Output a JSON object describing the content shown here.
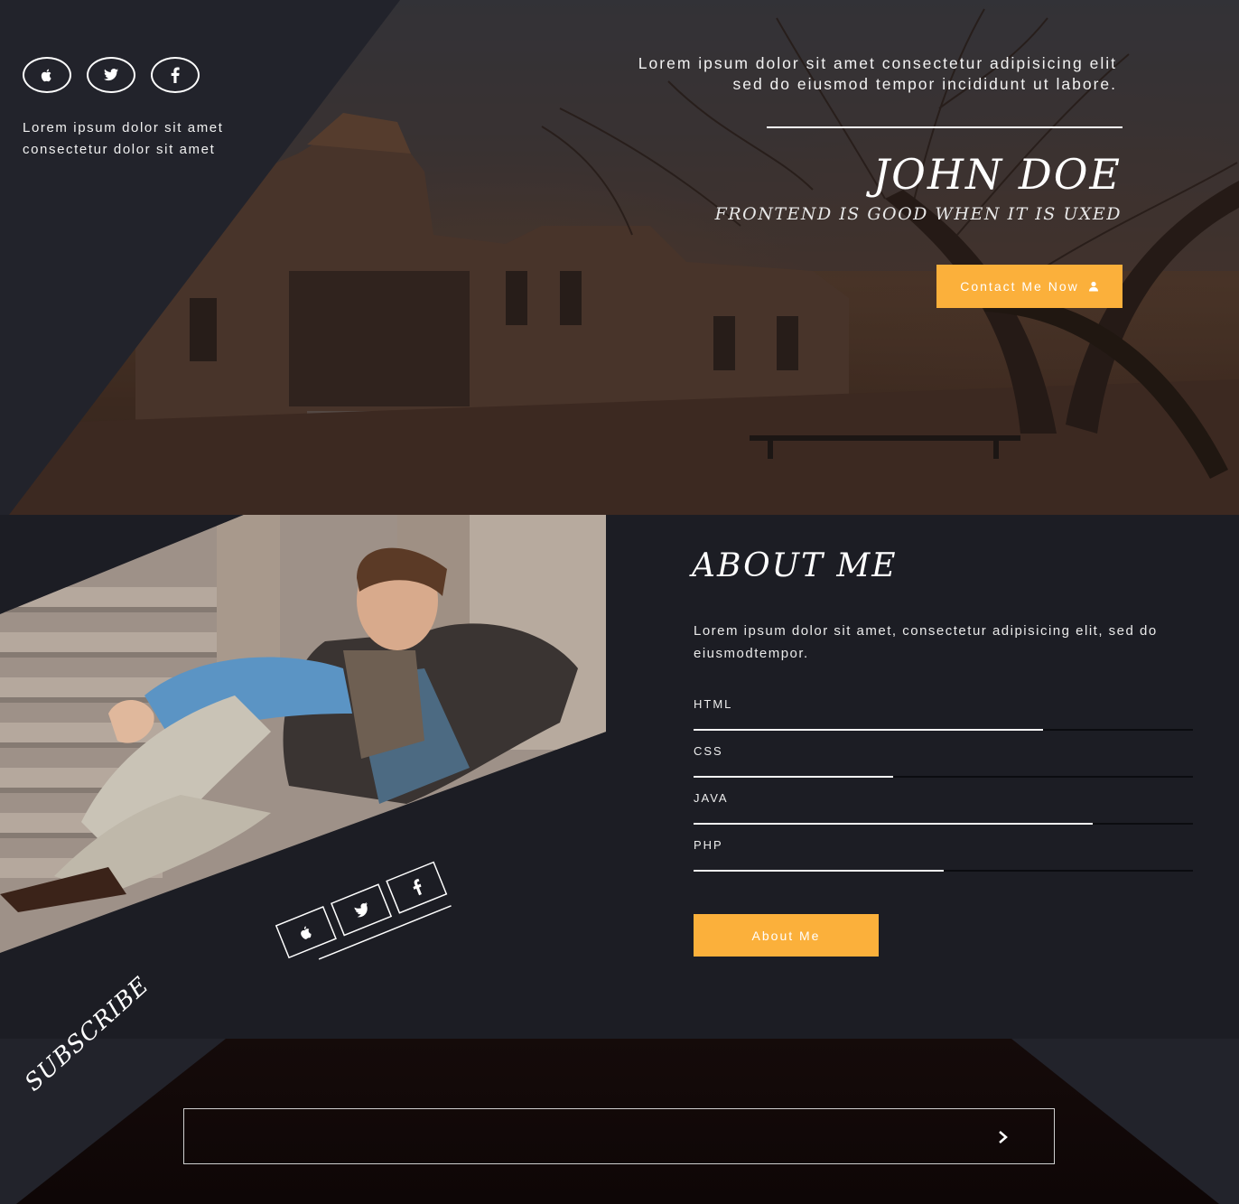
{
  "hero": {
    "social": [
      {
        "icon": "apple-icon"
      },
      {
        "icon": "twitter-icon"
      },
      {
        "icon": "facebook-icon"
      }
    ],
    "note_line1": "Lorem ipsum dolor sit amet",
    "note_line2": "consectetur dolor sit amet",
    "lead_line1": "Lorem ipsum dolor sit amet consectetur adipisicing elit",
    "lead_line2": "sed do eiusmod tempor incididunt ut labore.",
    "name": "JOHN DOE",
    "tagline": "FRONTEND IS GOOD WHEN IT IS UXED",
    "cta_label": "Contact Me Now",
    "cta_icon": "user-icon"
  },
  "about": {
    "title": "ABOUT ME",
    "text": "Lorem ipsum dolor sit amet, consectetur adipisicing elit, sed do eiusmodtempor.",
    "skills": [
      {
        "name": "HTML",
        "level": 0.7
      },
      {
        "name": "CSS",
        "level": 0.4
      },
      {
        "name": "JAVA",
        "level": 0.8
      },
      {
        "name": "PHP",
        "level": 0.5
      }
    ],
    "button_label": "About Me",
    "social": [
      {
        "icon": "apple-icon"
      },
      {
        "icon": "twitter-icon"
      },
      {
        "icon": "facebook-icon"
      }
    ]
  },
  "subscribe": {
    "label": "SUBSCRIBE",
    "input_value": "",
    "submit_icon": "chevron-right-icon"
  },
  "colors": {
    "accent": "#fbb03b",
    "background": "#1c1d24",
    "panel": "#22232b"
  }
}
